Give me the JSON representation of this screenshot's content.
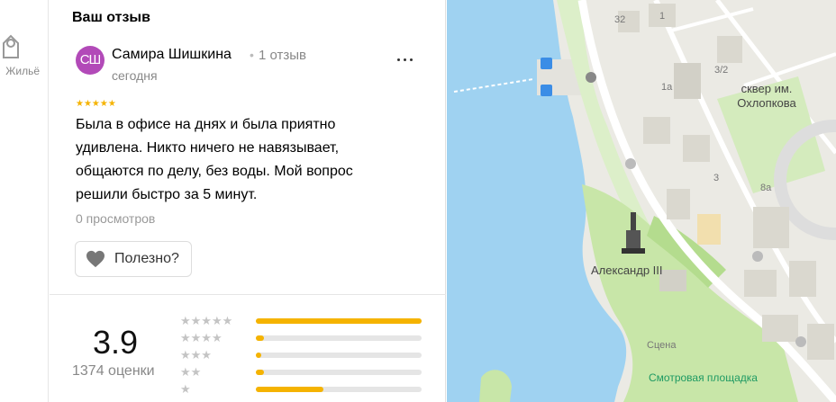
{
  "rail": {
    "item_label": "Жильё",
    "item_icon": "building-icon"
  },
  "review_section": {
    "title": "Ваш отзыв",
    "author": {
      "initials": "СШ",
      "avatar_color": "#b24ab8",
      "name": "Самира Шишкина",
      "separator": "•",
      "reviews_count": "1 отзыв",
      "date": "сегодня"
    },
    "stars": "★★★★★",
    "rating": 5,
    "text": "Была в офисе на днях и была приятно удивлена. Никто ничего не навязывает, общаются по делу, без воды. Мой вопрос решили быстро за 5 минут.",
    "views": "0 просмотров",
    "useful_label": "Полезно?"
  },
  "summary": {
    "rating": "3.9",
    "ratings_count": "1374 оценки",
    "distribution": [
      {
        "stars": 5,
        "label": "★★★★★",
        "fraction": 1.0
      },
      {
        "stars": 4,
        "label": "★★★★",
        "fraction": 0.05
      },
      {
        "stars": 3,
        "label": "★★★",
        "fraction": 0.03
      },
      {
        "stars": 2,
        "label": "★★",
        "fraction": 0.05
      },
      {
        "stars": 1,
        "label": "★",
        "fraction": 0.41
      }
    ],
    "accent_color": "#f5b300"
  },
  "map": {
    "labels": {
      "n32": "32",
      "n1": "1",
      "n3_2": "3/2",
      "n1a": "1а",
      "n3": "3",
      "n8a": "8а",
      "square": "сквер им. Охлопкова",
      "monument": "Александр III",
      "scene": "Сцена",
      "viewpoint": "Смотровая площадка"
    },
    "water_color": "#9fd2f1",
    "park_color": "#c8e6a8"
  }
}
